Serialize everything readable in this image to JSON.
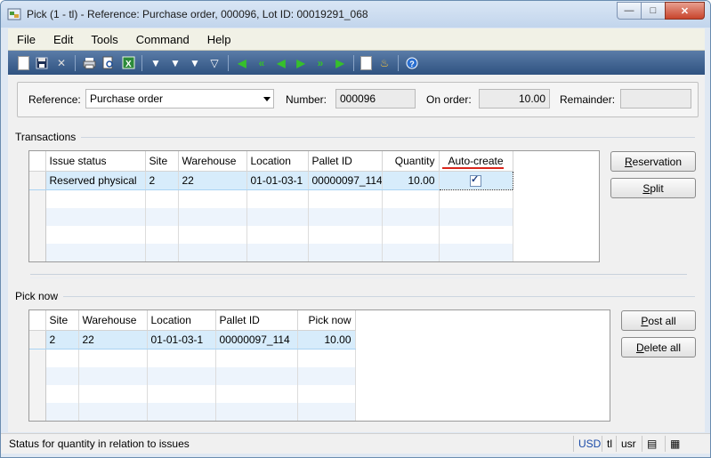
{
  "window": {
    "title": "Pick (1 - tl) - Reference: Purchase order, 000096, Lot ID: 00019291_068"
  },
  "menu": [
    "File",
    "Edit",
    "Tools",
    "Command",
    "Help"
  ],
  "header": {
    "reference_label": "Reference:",
    "reference_value": "Purchase order",
    "number_label": "Number:",
    "number_value": "000096",
    "on_order_label": "On order:",
    "on_order_value": "10.00",
    "remainder_label": "Remainder:",
    "remainder_value": ""
  },
  "transactions": {
    "title": "Transactions",
    "columns": [
      "Issue status",
      "Site",
      "Warehouse",
      "Location",
      "Pallet ID",
      "Quantity",
      "Auto-create"
    ],
    "rows": [
      {
        "issue_status": "Reserved physical",
        "site": "2",
        "warehouse": "22",
        "location": "01-01-03-1",
        "pallet_id": "00000097_114",
        "quantity": "10.00",
        "auto_create": true
      }
    ],
    "buttons": {
      "reservation": "Reservation",
      "split": "Split"
    }
  },
  "pick_now": {
    "title": "Pick now",
    "columns": [
      "Site",
      "Warehouse",
      "Location",
      "Pallet ID",
      "Pick now"
    ],
    "rows": [
      {
        "site": "2",
        "warehouse": "22",
        "location": "01-01-03-1",
        "pallet_id": "00000097_114",
        "pick_now": "10.00"
      }
    ],
    "buttons": {
      "post_all": "Post all",
      "delete_all": "Delete all"
    }
  },
  "status": {
    "text": "Status for quantity in relation to issues",
    "currency": "USD",
    "company": "tl",
    "user": "usr"
  },
  "colors": {
    "highlight": "#d9261c",
    "row_selected": "#d7ecfb",
    "toolbar": "#2f5280"
  },
  "icons": [
    "window-icon",
    "new-icon",
    "save-icon",
    "delete-icon",
    "print-icon",
    "print-preview-icon",
    "excel-icon",
    "filter-by-selection-icon",
    "filter-by-grid-icon",
    "advanced-filter-icon",
    "remove-filter-icon",
    "first-record-icon",
    "previous-page-icon",
    "previous-record-icon",
    "next-record-icon",
    "next-page-icon",
    "last-record-icon",
    "document-handling-icon",
    "alert-icon",
    "help-icon"
  ]
}
